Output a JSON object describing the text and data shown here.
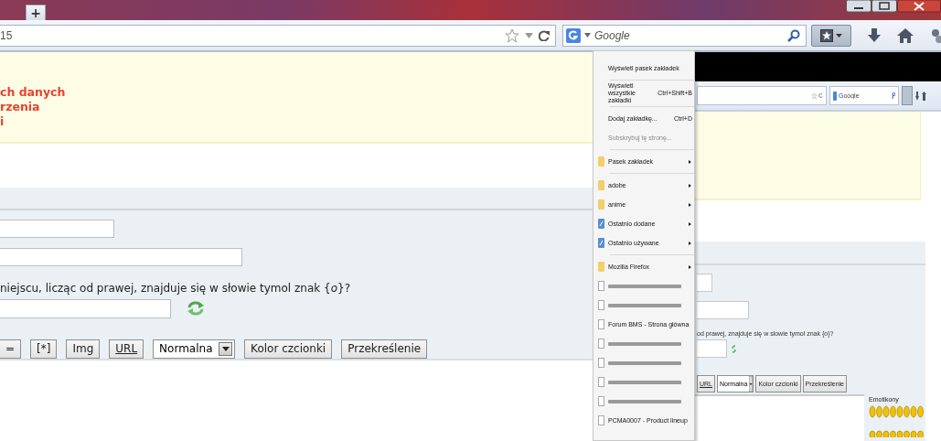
{
  "tab_strip": {
    "new_tab_button": "+"
  },
  "toolbar": {
    "address": "15",
    "search_placeholder": "Google"
  },
  "notice": {
    "lines": [
      "ch danych",
      "rzenia",
      "i"
    ]
  },
  "form": {
    "question": "niejscu, licząc od prawej, znajduje się w słowie tymol znak {*o*}?",
    "format_buttons": [
      {
        "label": "=",
        "underlined": false
      },
      {
        "label": "[*]",
        "underlined": false
      },
      {
        "label": "Img",
        "underlined": false
      },
      {
        "label": "URL",
        "underlined": true
      }
    ],
    "size_select": "Normalna",
    "more_buttons": [
      "Kolor czcionki",
      "Przekreślenie"
    ]
  },
  "bookmarks_menu": {
    "items": [
      {
        "kind": "item",
        "label": "Wyświetl pasek zakładek",
        "disabled": false
      },
      {
        "kind": "separator"
      },
      {
        "kind": "item",
        "label": "Wyświetl wszystkie zakładki",
        "shortcut": "Ctrl+Shift+B",
        "disabled": false
      },
      {
        "kind": "separator"
      },
      {
        "kind": "item",
        "label": "Dodaj zakładkę...",
        "shortcut": "Ctrl+D",
        "disabled": false
      },
      {
        "kind": "item",
        "label": "Subskrybuj tę stronę...",
        "disabled": true
      },
      {
        "kind": "separator"
      },
      {
        "kind": "folder",
        "label": "Pasek zakładek"
      },
      {
        "kind": "separator"
      },
      {
        "kind": "folder",
        "label": "adobe"
      },
      {
        "kind": "folder",
        "label": "anime"
      },
      {
        "kind": "smart",
        "label": "Ostatnio dodane"
      },
      {
        "kind": "smart",
        "label": "Ostatnio używane"
      },
      {
        "kind": "separator"
      },
      {
        "kind": "folder",
        "label": "Mozilla Firefox"
      },
      {
        "kind": "page"
      },
      {
        "kind": "page"
      },
      {
        "kind": "page",
        "label": "Forum BMS - Strona główna"
      },
      {
        "kind": "page"
      },
      {
        "kind": "page"
      },
      {
        "kind": "page"
      },
      {
        "kind": "page"
      },
      {
        "kind": "page",
        "label": "PCMA0007 - Product lineup"
      }
    ]
  },
  "preview": {
    "search_placeholder": "Google",
    "question": "od prawej, znajduje się w słowie tymol znak {*o*}?",
    "format_buttons": [
      "URL"
    ],
    "size_select": "Normalna",
    "more_buttons": [
      "Kolor czcionki",
      "Przekreślenie"
    ],
    "emoticons_label": "Emotikony"
  }
}
